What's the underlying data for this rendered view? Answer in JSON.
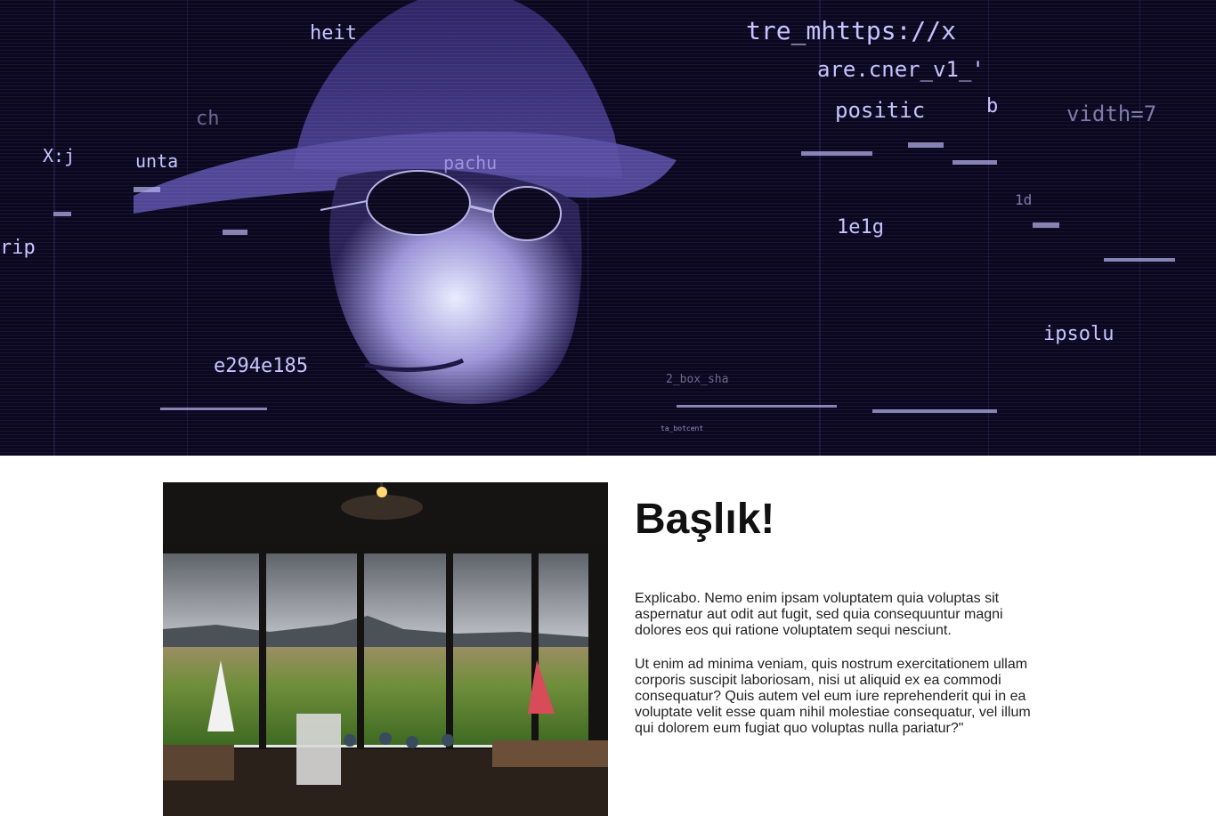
{
  "hero": {
    "image_label": "hacker with hat and sunglasses surrounded by code",
    "code_fragments": [
      "heit",
      "tre_mhttps://x",
      "are.cner_v1_'",
      "positic",
      "b",
      "vidth=7",
      "X:j",
      "unta",
      "ch",
      "rip",
      "e294e185",
      "1e1g",
      "ipsolu",
      "pachu",
      "2_box_sha",
      "ta_botcent",
      "1d"
    ]
  },
  "article": {
    "photo_label": "restaurant interior with vineyard view",
    "title": "Başlık!",
    "paragraph1": "Explicabo. Nemo enim ipsam voluptatem quia voluptas sit aspernatur aut odit aut fugit, sed quia consequuntur magni dolores eos qui ratione voluptatem sequi nesciunt.",
    "paragraph2": "Ut enim ad minima veniam, quis nostrum exercitationem ullam corporis suscipit laboriosam, nisi ut aliquid ex ea commodi consequatur? Quis autem vel eum iure reprehenderit qui in ea voluptate velit esse quam nihil molestiae consequatur, vel illum qui dolorem eum fugiat quo voluptas nulla pariatur?\""
  }
}
